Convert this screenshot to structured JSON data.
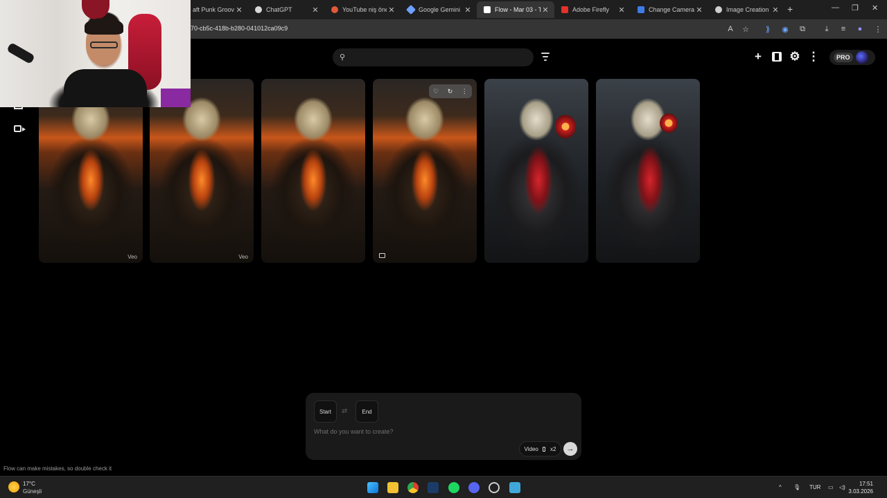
{
  "browser": {
    "tabs": [
      {
        "title": "aft Punk Groove",
        "favicon_color": "#e3e3e3",
        "active": false
      },
      {
        "title": "ChatGPT",
        "favicon_color": "#d8d8d8",
        "active": false
      },
      {
        "title": "YouTube niş öneri",
        "favicon_color": "#e05a3a",
        "active": false
      },
      {
        "title": "Google Gemini",
        "favicon_color": "#6fa0ff",
        "active": false
      },
      {
        "title": "Flow - Mar 03 - T",
        "favicon_color": "#ffffff",
        "active": true
      },
      {
        "title": "Adobe Firefly",
        "favicon_color": "#e2322a",
        "active": false
      },
      {
        "title": "Change Camera",
        "favicon_color": "#3f7be8",
        "active": false
      },
      {
        "title": "Image Creation",
        "favicon_color": "#cfcfcf",
        "active": false
      }
    ],
    "close_glyph": "✕",
    "new_tab_glyph": "+",
    "url": "70-cb5c-418b-b280-041012ca09c9"
  },
  "app": {
    "search": {
      "placeholder": ""
    },
    "pro_label": "PRO",
    "cards": [
      {
        "theme": "fire",
        "tag": "Veo"
      },
      {
        "theme": "fire",
        "tag": "Veo"
      },
      {
        "theme": "fire",
        "tag": ""
      },
      {
        "theme": "fire",
        "tag": ""
      },
      {
        "theme": "lab",
        "tag": ""
      },
      {
        "theme": "lab",
        "tag": ""
      }
    ],
    "prompt": {
      "start_label": "Start",
      "end_label": "End",
      "placeholder": "What do you want to create?",
      "mode_label": "Video",
      "count_label": "x2"
    },
    "disclaimer": "Flow can make mistakes, so double check it"
  },
  "taskbar": {
    "weather_temp": "17°C",
    "weather_desc": "Güneşli",
    "language": "TUR",
    "time": "17:51",
    "date": "3.03.2026"
  }
}
